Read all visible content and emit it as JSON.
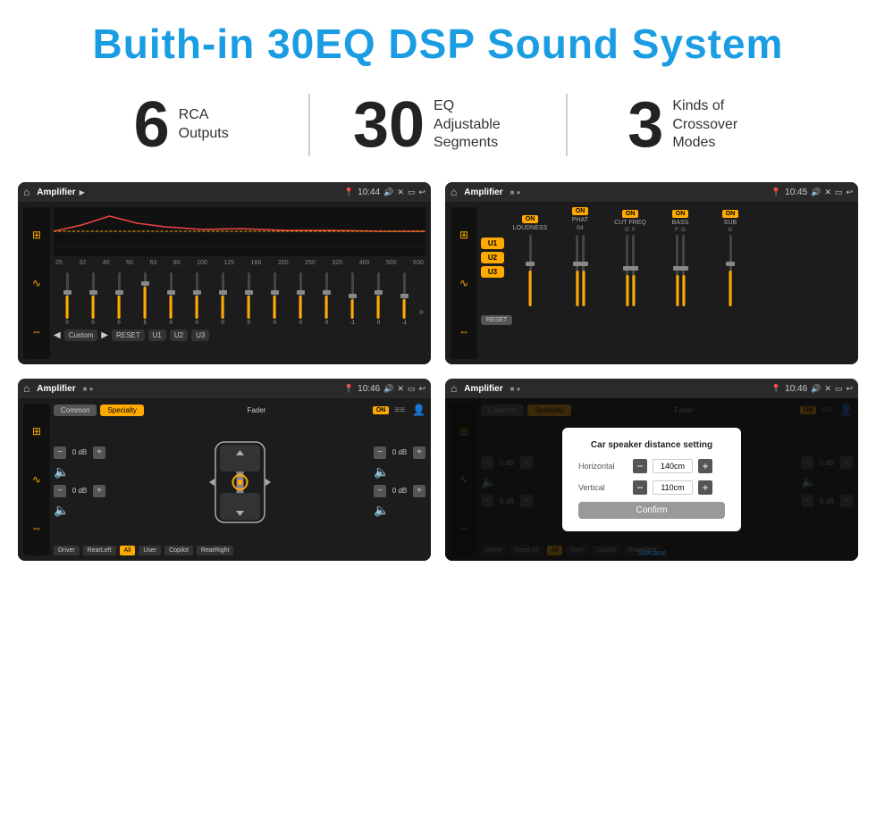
{
  "header": {
    "title": "Buith-in 30EQ DSP Sound System"
  },
  "features": [
    {
      "number": "6",
      "text": "RCA\nOutputs"
    },
    {
      "number": "30",
      "text": "EQ Adjustable\nSegments"
    },
    {
      "number": "3",
      "text": "Kinds of\nCrossover Modes"
    }
  ],
  "screens": {
    "screen1": {
      "title": "Amplifier",
      "time": "10:44",
      "freqs": [
        "25",
        "32",
        "40",
        "50",
        "63",
        "80",
        "100",
        "125",
        "160",
        "200",
        "250",
        "320",
        "400",
        "500",
        "630"
      ],
      "values": [
        "0",
        "0",
        "0",
        "5",
        "0",
        "0",
        "0",
        "0",
        "0",
        "0",
        "0",
        "-1",
        "0",
        "-1"
      ],
      "buttons": [
        "Custom",
        "RESET",
        "U1",
        "U2",
        "U3"
      ]
    },
    "screen2": {
      "title": "Amplifier",
      "time": "10:45",
      "uButtons": [
        "U1",
        "U2",
        "U3"
      ],
      "channels": [
        {
          "label": "ON",
          "name": "LOUDNESS",
          "sub": ""
        },
        {
          "label": "ON",
          "name": "PHAT",
          "sub": ""
        },
        {
          "label": "ON",
          "name": "CUT FREQ",
          "sub": "G  F"
        },
        {
          "label": "ON",
          "name": "BASS",
          "sub": "F  G"
        },
        {
          "label": "ON",
          "name": "SUB",
          "sub": "G"
        }
      ],
      "resetLabel": "RESET"
    },
    "screen3": {
      "title": "Amplifier",
      "time": "10:46",
      "tabs": [
        "Common",
        "Specialty"
      ],
      "activeTab": "Specialty",
      "onLabel": "ON",
      "faderLabel": "Fader",
      "dbValues": [
        "0 dB",
        "0 dB",
        "0 dB",
        "0 dB"
      ],
      "bottomBtns": [
        "Driver",
        "RearLeft",
        "All",
        "User",
        "Copilot",
        "RearRight"
      ]
    },
    "screen4": {
      "title": "Amplifier",
      "time": "10:46",
      "tabs": [
        "Common",
        "Specialty"
      ],
      "activeTab": "Specialty",
      "onLabel": "ON",
      "dialog": {
        "title": "Car speaker distance setting",
        "rows": [
          {
            "label": "Horizontal",
            "value": "140cm"
          },
          {
            "label": "Vertical",
            "value": "110cm"
          }
        ],
        "confirmLabel": "Confirm"
      },
      "dbValues": [
        "0 dB",
        "0 dB"
      ],
      "bottomBtns": [
        "Driver",
        "RearLeft",
        "All",
        "User",
        "Copilot",
        "RearRight"
      ]
    }
  },
  "watermark": "Seicane"
}
